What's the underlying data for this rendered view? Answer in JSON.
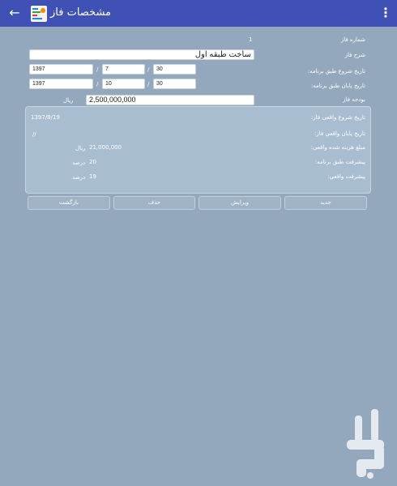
{
  "app_bar": {
    "title": "مشخصات فاز",
    "back_icon": "arrow-back-icon",
    "menu_icon": "more-vert-icon",
    "app_icon": "app-logo-icon",
    "color": "#3f51b5"
  },
  "form": {
    "phase_number": {
      "label": "شماره فاز",
      "value": "1"
    },
    "phase_description": {
      "label": "شرح فاز",
      "value": "ساخت طبقه اول"
    },
    "planned_start": {
      "label": "تاریخ شروع طبق برنامه:",
      "year": "1397",
      "month": "7",
      "day": "30",
      "separator": "/"
    },
    "planned_end": {
      "label": "تاریخ پایان طبق برنامه:",
      "year": "1397",
      "month": "10",
      "day": "30",
      "separator": "/"
    },
    "budget": {
      "label": "بودجه فاز",
      "value": "2,500,000,000",
      "unit": "ریال"
    }
  },
  "summary": {
    "actual_start": {
      "label": "تاریخ شروع واقعی فاز:",
      "value": "1397/8/19"
    },
    "actual_end": {
      "label": "تاریخ پایان واقعی فاز:",
      "value": "//"
    },
    "actual_cost": {
      "label": "مبلغ هزینه شده واقعی:",
      "value": "21,000,000",
      "unit": "ریال"
    },
    "planned_progress": {
      "label": "پیشرفت طبق برنامه:",
      "value": "20",
      "unit": "درصد"
    },
    "actual_progress": {
      "label": "پیشرفت واقعی:",
      "value": "19",
      "unit": "درصد"
    }
  },
  "buttons": {
    "new": "جدید",
    "edit": "ویرایش",
    "delete": "حذف",
    "back": "بازگشت"
  },
  "watermark_icon": "bazaar-logo-icon"
}
